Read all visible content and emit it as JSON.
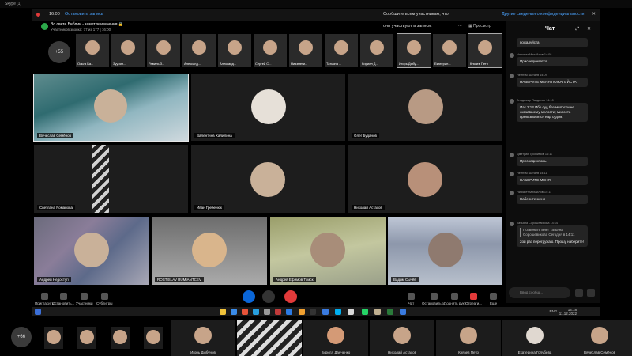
{
  "titlebar": {
    "title": "Skype [1]"
  },
  "banner": {
    "time": "16:00",
    "stop": "Остановить запись",
    "message": "Сообщите всем участникам, что они участвуют в записи.",
    "link": "Другие сведения о конфиденциальности",
    "close": "✕"
  },
  "header": {
    "title": "Во свете Библии - заметки и мнения 🔒",
    "subtitle": "Участников звонка: 77 из 177 | 16:00"
  },
  "topstrip": {
    "more": "+55",
    "view": "Просмотр",
    "people": [
      "Ольга Ба...",
      "Зуурин...",
      "Равиль З...",
      "Александ...",
      "Александ...",
      "Сергей С...",
      "Ниязмети...",
      "Татьяна ...",
      "Кирилл Д...",
      "Игорь Дыбу...",
      "Екатерин...",
      "Князев Петр"
    ]
  },
  "tiles": [
    {
      "name": "Вячеслав Семёнов"
    },
    {
      "name": "Валентина Халилина"
    },
    {
      "name": "Олег Буданов"
    },
    {
      "name": "Светлана Романова"
    },
    {
      "name": "Иван Гребенюк"
    },
    {
      "name": "Николай Астахов"
    },
    {
      "name": "Андрей Недоступ"
    },
    {
      "name": "ROSTISLAV RUMIANTCEV"
    },
    {
      "name": "Андрей Ефимов Томск"
    },
    {
      "name": "Вадим Сычёв"
    }
  ],
  "controls": {
    "invite": "Пригласить",
    "stop_sharing": "Остановить...",
    "participants": "Участники",
    "subtitles": "Субтитры",
    "chat": "Чат",
    "stop_recording": "Остановить з...",
    "raise_hand": "Поднять руку",
    "react": "Отреаги...",
    "more": "Еще"
  },
  "chat": {
    "title": "Чат",
    "input_placeholder": "Ввод сообщ...",
    "messages": [
      {
        "who": "",
        "text": "пожалуйста"
      },
      {
        "who": "Ниязмет Михайлов 14:08",
        "text": "Присоединяется"
      },
      {
        "who": "Нейнэм Шатаев 14:09",
        "text": "НАБЕРИТЕ МЕНЯ ПОЖАЛУЙСТА"
      },
      {
        "who": "Владимир Павденко 14:10",
        "text": "Иак.2:13 Ибо суд без милости не оказавшему милости; милость превозносится над судом."
      },
      {
        "who": "Дмитрий Трофимов 14:11",
        "text": "Присоединяюсь"
      },
      {
        "who": "Нейнэм Шатаев 14:11",
        "text": "НАБЕРИТЕ МЕНЯ"
      },
      {
        "who": "Ниязмет Михайлов 14:11",
        "text": "Наберите меня"
      },
      {
        "who": "Татьяна Сорошевикова 14:14",
        "quote": "Позвоните мне! Татьяна Сорошевикова Сегодня в 14:11",
        "text": "2ой раз перегружаю. Прошу наберите!"
      }
    ]
  },
  "taskbar": {
    "lang": "ENG",
    "time": "14:18",
    "date": "11.12.2022"
  },
  "bottomstrip": {
    "more": "+66",
    "people": [
      "Игорь Дыбунов",
      "",
      "Кирилл Данченко",
      "Николай Астахов",
      "Князев Петр",
      "Екатерина Голубева",
      "Вячеслав Семёнов"
    ]
  }
}
